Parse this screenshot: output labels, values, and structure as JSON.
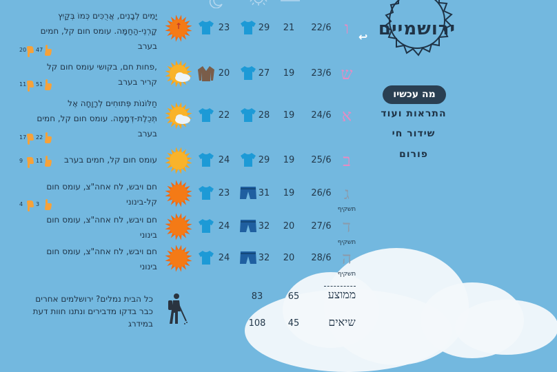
{
  "logo": {
    "text": "ירושמיים"
  },
  "nav": {
    "now_button": "מה עכשיו",
    "items": [
      "התראות ועוד",
      "שידור חי",
      "פורום"
    ]
  },
  "days": [
    {
      "letter": "ו",
      "note": "",
      "date": "22/6",
      "low": "21",
      "high": "29",
      "temp2": "23",
      "icon": "sun-hot-icon",
      "desc": [
        "יָמִים לְבָנִים, אֲרֻכִּים כְּמוֹ בְּקַיִץ",
        "קָרְנֵי-הַחַמָּה. עומס חום קל, חמים",
        "בערב"
      ],
      "poll": {
        "a": "20",
        "b": "47"
      }
    },
    {
      "letter": "ש",
      "note": "",
      "date": "23/6",
      "low": "19",
      "high": "27",
      "temp2": "20",
      "icon": "sun-cloud-icon",
      "desc": [
        "פחות חם, בקושי עומס חום קל,",
        "קריר בערב"
      ],
      "poll": {
        "a": "11",
        "b": "51"
      }
    },
    {
      "letter": "א",
      "note": "",
      "date": "24/6",
      "low": "19",
      "high": "28",
      "temp2": "22",
      "icon": "sun-cloud-icon",
      "desc": [
        "חַלּוֹנוֹת פְּתוּחִים לְרָוָחָה אֶל",
        "תְּכֵלֶת-דְּמָמָה. עומס חום קל, חמים",
        "בערב"
      ],
      "poll": {
        "a": "17",
        "b": "22"
      }
    },
    {
      "letter": "ב",
      "note": "",
      "date": "25/6",
      "low": "19",
      "high": "29",
      "temp2": "24",
      "icon": "sun-icon",
      "desc": [
        "עומס חום קל, חמים בערב"
      ],
      "poll": {
        "a": "9",
        "b": "11"
      }
    },
    {
      "letter": "ג",
      "note": "תשקיף",
      "date": "26/6",
      "low": "19",
      "high": "31",
      "temp2": "23",
      "icon": "sun-hot-icon",
      "desc": [
        "חם ויבש, לח אחה\"צ, עומס חום",
        "קל-בינוני"
      ],
      "poll": {
        "a": "4",
        "b": "3"
      }
    },
    {
      "letter": "ד",
      "note": "תשקיף",
      "date": "27/6",
      "low": "20",
      "high": "32",
      "temp2": "24",
      "icon": "sun-hot-icon",
      "desc": [
        "חם ויבש, לח אחה\"צ, עומס חום",
        "בינוני"
      ],
      "poll": null
    },
    {
      "letter": "ה",
      "note": "תשקיף",
      "date": "28/6",
      "low": "20",
      "high": "32",
      "temp2": "24",
      "icon": "sun-hot-icon",
      "desc": [
        "חם ויבש, לח אחה\"צ, עומס חום",
        "בינוני"
      ],
      "poll": null
    }
  ],
  "summary": {
    "avg_label": "ממוצע",
    "avg_low": "65",
    "avg_high": "83",
    "peak_label": "שיאים",
    "peak_low": "45",
    "peak_high": "108"
  },
  "ask": {
    "text": [
      "כל הבית נמלים? ירושלמים אחרים",
      "כבר בדקו מדבירים ונתנו חוות דעת",
      "במידרג"
    ]
  },
  "colors": {
    "letter": "#e58cc3",
    "sky": "#73b8df",
    "accent": "#2a3f52"
  }
}
